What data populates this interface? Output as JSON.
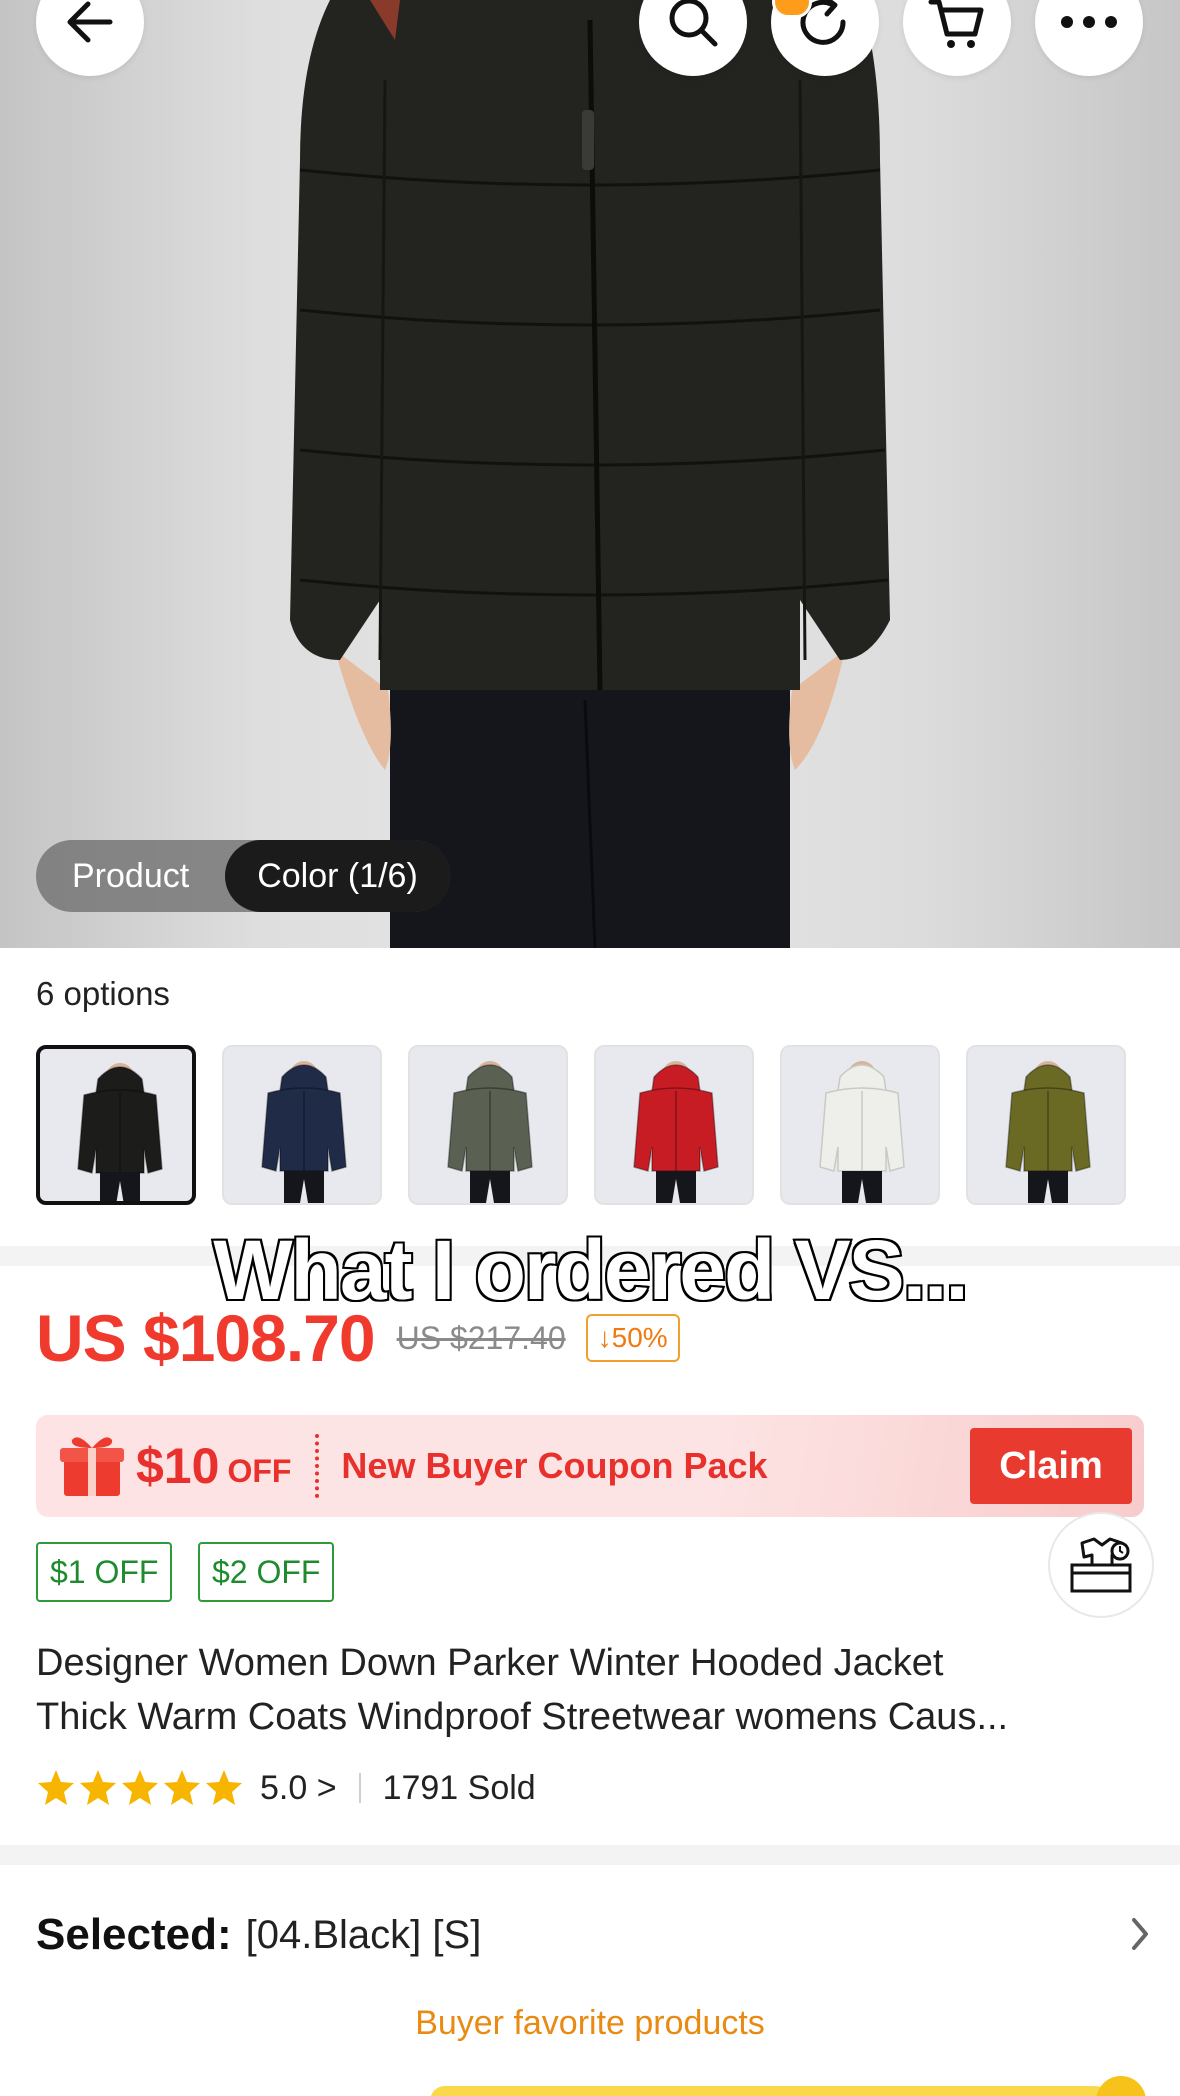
{
  "header": {
    "back_icon": "arrow-left-icon",
    "actions": [
      "search-icon",
      "share-icon",
      "cart-icon",
      "more-icon"
    ]
  },
  "media": {
    "tabs": [
      {
        "label": "Product",
        "active": false
      },
      {
        "label": "Color (1/6)",
        "active": true
      }
    ]
  },
  "options": {
    "title": "6 options",
    "colors": [
      "#1c1d1b",
      "#1f2b47",
      "#5a6052",
      "#c81c24",
      "#eeeeea",
      "#6b6a25"
    ],
    "selected_index": 0
  },
  "overlay_caption": "What I ordered VS...",
  "price": {
    "current": "US $108.70",
    "original": "US $217.40",
    "discount": "↓50%"
  },
  "coupon": {
    "amount": "$10",
    "off": "OFF",
    "label": "New Buyer Coupon Pack",
    "button": "Claim"
  },
  "chips": [
    "$1 OFF",
    "$2 OFF"
  ],
  "product": {
    "title_line1": "Designer Women Down Parker Winter Hooded Jacket",
    "title_line2": "Thick Warm Coats Windproof Streetwear womens Caus..."
  },
  "rating": {
    "stars": 5,
    "value": "5.0 >",
    "sold": "1791 Sold"
  },
  "selection": {
    "label": "Selected:",
    "value": "[04.Black] [S]"
  },
  "section": {
    "buyer_favorites": "Buyer favorite products"
  },
  "colors": {
    "price_red": "#f03a2e",
    "coupon_green": "#1e8c2e",
    "accent_orange": "#e98a12"
  }
}
